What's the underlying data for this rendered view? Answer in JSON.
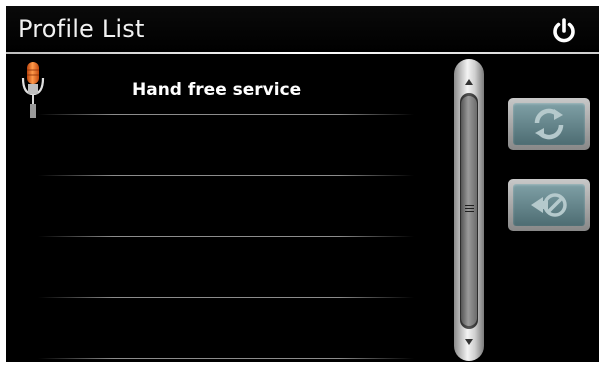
{
  "header": {
    "title": "Profile List",
    "power_icon": "power-icon"
  },
  "profiles": [
    {
      "label": "Hand free service",
      "icon": "microphone-icon"
    },
    {
      "label": ""
    },
    {
      "label": ""
    },
    {
      "label": ""
    },
    {
      "label": ""
    }
  ],
  "side_buttons": [
    {
      "icon": "refresh-icon",
      "enabled": false
    },
    {
      "icon": "disconnect-icon",
      "enabled": false
    }
  ],
  "colors": {
    "background": "#000000",
    "title_text": "#f2f2f2",
    "button_teal": "#5f8088",
    "mic_orange": "#e8671c"
  }
}
